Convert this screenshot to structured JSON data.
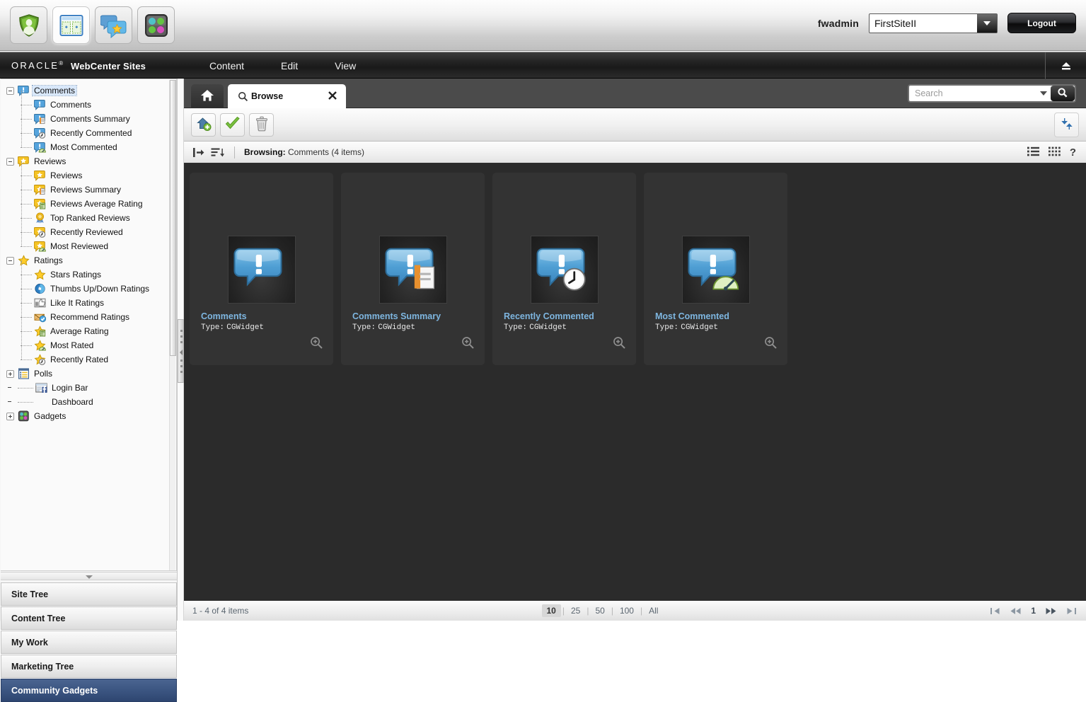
{
  "app_bar": {
    "launchers": [
      {
        "name": "admin-shield-icon",
        "title": "Admin"
      },
      {
        "name": "site-layout-icon",
        "title": "Contributor"
      },
      {
        "name": "community-chat-icon",
        "title": "Community"
      },
      {
        "name": "gadgets-dots-icon",
        "title": "Gadgets"
      }
    ],
    "username": "fwadmin",
    "site_select": {
      "value": "FirstSiteII",
      "options": [
        "FirstSiteII"
      ]
    },
    "logout_label": "Logout"
  },
  "nav_bar": {
    "brand": "ORACLE",
    "brand_reg": "®",
    "product": "WebCenter Sites",
    "menu": [
      {
        "label": "Content"
      },
      {
        "label": "Edit"
      },
      {
        "label": "View"
      }
    ],
    "eject_icon": "eject-icon"
  },
  "sidebar": {
    "tree": [
      {
        "label": "Comments",
        "level": 0,
        "expander": "minus",
        "icon": "comment-bubble-blue-icon",
        "selected": true
      },
      {
        "label": "Comments",
        "level": 1,
        "icon": "comment-bubble-blue-icon"
      },
      {
        "label": "Comments Summary",
        "level": 1,
        "icon": "comment-summary-icon"
      },
      {
        "label": "Recently Commented",
        "level": 1,
        "icon": "comment-clock-icon"
      },
      {
        "label": "Most Commented",
        "level": 1,
        "icon": "comment-gauge-icon"
      },
      {
        "label": "Reviews",
        "level": 0,
        "expander": "minus",
        "icon": "review-star-bubble-icon"
      },
      {
        "label": "Reviews",
        "level": 1,
        "icon": "review-star-bubble-icon"
      },
      {
        "label": "Reviews Summary",
        "level": 1,
        "icon": "review-summary-icon"
      },
      {
        "label": "Reviews Average Rating",
        "level": 1,
        "icon": "review-average-icon"
      },
      {
        "label": "Top Ranked Reviews",
        "level": 1,
        "icon": "award-medal-icon"
      },
      {
        "label": "Recently Reviewed",
        "level": 1,
        "icon": "review-clock-icon"
      },
      {
        "label": "Most Reviewed",
        "level": 1,
        "icon": "review-gauge-icon"
      },
      {
        "label": "Ratings",
        "level": 0,
        "expander": "minus",
        "icon": "star-yellow-icon"
      },
      {
        "label": "Stars Ratings",
        "level": 1,
        "icon": "star-yellow-icon"
      },
      {
        "label": "Thumbs Up/Down Ratings",
        "level": 1,
        "icon": "thumbs-updown-icon"
      },
      {
        "label": "Like It Ratings",
        "level": 1,
        "icon": "thumbs-up-icon"
      },
      {
        "label": "Recommend Ratings",
        "level": 1,
        "icon": "recommend-envelope-icon"
      },
      {
        "label": "Average Rating",
        "level": 1,
        "icon": "star-calculator-icon"
      },
      {
        "label": "Most Rated",
        "level": 1,
        "icon": "star-gauge-icon"
      },
      {
        "label": "Recently Rated",
        "level": 1,
        "icon": "star-clock-icon"
      },
      {
        "label": "Polls",
        "level": 0,
        "expander": "plus",
        "icon": "poll-list-icon"
      },
      {
        "label": "Login Bar",
        "level": 0,
        "expander": "none",
        "icon": "login-bar-icon"
      },
      {
        "label": "Dashboard",
        "level": 0,
        "expander": "none",
        "icon": "none"
      },
      {
        "label": "Gadgets",
        "level": 0,
        "expander": "plus",
        "icon": "gadgets-dots-icon"
      }
    ],
    "panels": [
      {
        "label": "Site Tree",
        "active": false
      },
      {
        "label": "Content Tree",
        "active": false
      },
      {
        "label": "My Work",
        "active": false
      },
      {
        "label": "Marketing Tree",
        "active": false
      },
      {
        "label": "Community Gadgets",
        "active": true
      }
    ]
  },
  "tabs": {
    "home_icon": "home-icon",
    "browse": {
      "icon": "magnifier-icon",
      "label": "Browse",
      "close_icon": "close-icon"
    }
  },
  "search": {
    "placeholder": "Search",
    "value": "",
    "dropdown_icon": "chevron-down-icon",
    "go_icon": "search-icon"
  },
  "toolbar": {
    "buttons": [
      {
        "name": "share-add-button",
        "icon": "share-add-icon"
      },
      {
        "name": "approve-button",
        "icon": "green-check-icon"
      },
      {
        "name": "delete-button",
        "icon": "trash-icon"
      }
    ],
    "refresh": {
      "name": "refresh-button",
      "icon": "refresh-icon"
    }
  },
  "browse_bar": {
    "collapse_icon": "collapse-panel-icon",
    "sort_icon": "sort-descending-icon",
    "label": "Browsing:",
    "context": "Comments (4 items)",
    "view_icons": [
      {
        "name": "list-view-icon"
      },
      {
        "name": "grid-view-icon"
      },
      {
        "name": "help-icon",
        "glyph": "?"
      }
    ]
  },
  "assets": [
    {
      "title": "Comments",
      "type_label": "Type:",
      "type_value": "CGWidget",
      "thumb_icon": "comment-bubble-blue-icon",
      "variant": "plain"
    },
    {
      "title": "Comments Summary",
      "type_label": "Type:",
      "type_value": "CGWidget",
      "thumb_icon": "comment-summary-icon",
      "variant": "doc"
    },
    {
      "title": "Recently Commented",
      "type_label": "Type:",
      "type_value": "CGWidget",
      "thumb_icon": "comment-clock-icon",
      "variant": "clock"
    },
    {
      "title": "Most Commented",
      "type_label": "Type:",
      "type_value": "CGWidget",
      "thumb_icon": "comment-gauge-icon",
      "variant": "gauge"
    }
  ],
  "footer": {
    "count_text": "1 - 4 of 4 items",
    "page_sizes": [
      {
        "label": "10",
        "active": true
      },
      {
        "label": "25",
        "active": false
      },
      {
        "label": "50",
        "active": false
      },
      {
        "label": "100",
        "active": false
      },
      {
        "label": "All",
        "active": false
      }
    ],
    "pager": {
      "first_icon": "first-page-icon",
      "prev_icon": "prev-page-icon",
      "current": "1",
      "next_icon": "next-page-icon",
      "last_icon": "last-page-icon"
    }
  },
  "colors": {
    "accent_blue": "#7eb6e0",
    "panel_active": "#3a5480",
    "asset_bg": "#2b2b2b",
    "card_bg": "#333333",
    "nav_bar": "#242424"
  }
}
